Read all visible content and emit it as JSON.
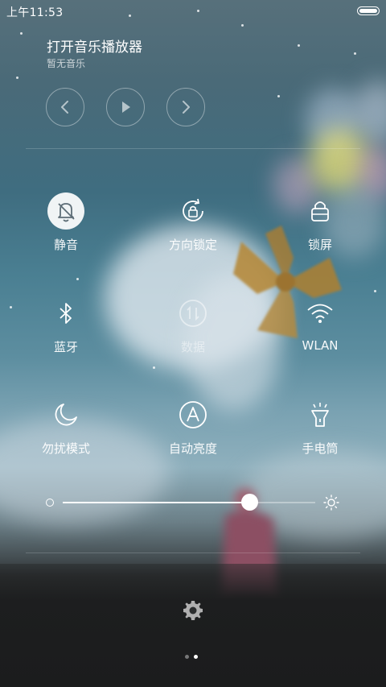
{
  "status_bar": {
    "time": "上午11:53",
    "battery_icon": "battery-full-icon"
  },
  "music": {
    "title": "打开音乐播放器",
    "subtitle": "暂无音乐",
    "controls": [
      "previous-icon",
      "play-icon",
      "next-icon"
    ]
  },
  "toggles": [
    {
      "label": "静音",
      "icon": "bell-muted-icon",
      "active": true
    },
    {
      "label": "方向锁定",
      "icon": "rotation-lock-icon",
      "active": false
    },
    {
      "label": "锁屏",
      "icon": "lock-icon",
      "active": false
    },
    {
      "label": "蓝牙",
      "icon": "bluetooth-icon",
      "active": false
    },
    {
      "label": "数据",
      "icon": "mobile-data-icon",
      "active": false,
      "disabled": true
    },
    {
      "label": "WLAN",
      "icon": "wifi-icon",
      "active": false
    },
    {
      "label": "勿扰模式",
      "icon": "moon-icon",
      "active": false
    },
    {
      "label": "自动亮度",
      "icon": "auto-brightness-icon",
      "active": false
    },
    {
      "label": "手电筒",
      "icon": "flashlight-icon",
      "active": false
    }
  ],
  "brightness": {
    "level": 0.74,
    "min_icon": "brightness-low-icon",
    "max_icon": "brightness-high-icon"
  },
  "settings_icon": "gear-icon",
  "pager": {
    "pages": 2,
    "current": 2
  },
  "colors": {
    "active_bg": "#ffffff",
    "active_fg": "#5a6a72",
    "text": "#ffffff"
  }
}
